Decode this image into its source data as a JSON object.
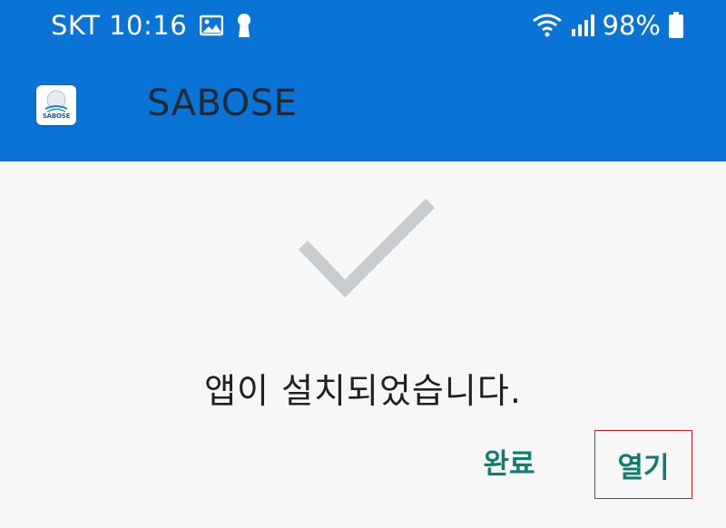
{
  "status_bar": {
    "carrier_time": "SKT 10:16",
    "battery": "98%",
    "icons": [
      "gallery-icon",
      "keyhole-icon",
      "wifi-icon",
      "signal-icon",
      "battery-icon"
    ]
  },
  "app_bar": {
    "title": "SABOSE",
    "icon_brand": "SABOSE"
  },
  "dialog": {
    "message": "앱이 설치되었습니다.",
    "done_label": "완료",
    "open_label": "열기"
  },
  "colors": {
    "primary": "#0a74d6",
    "accent": "#0f7d73",
    "highlight": "#d21f1f",
    "check": "#c9cccf"
  }
}
